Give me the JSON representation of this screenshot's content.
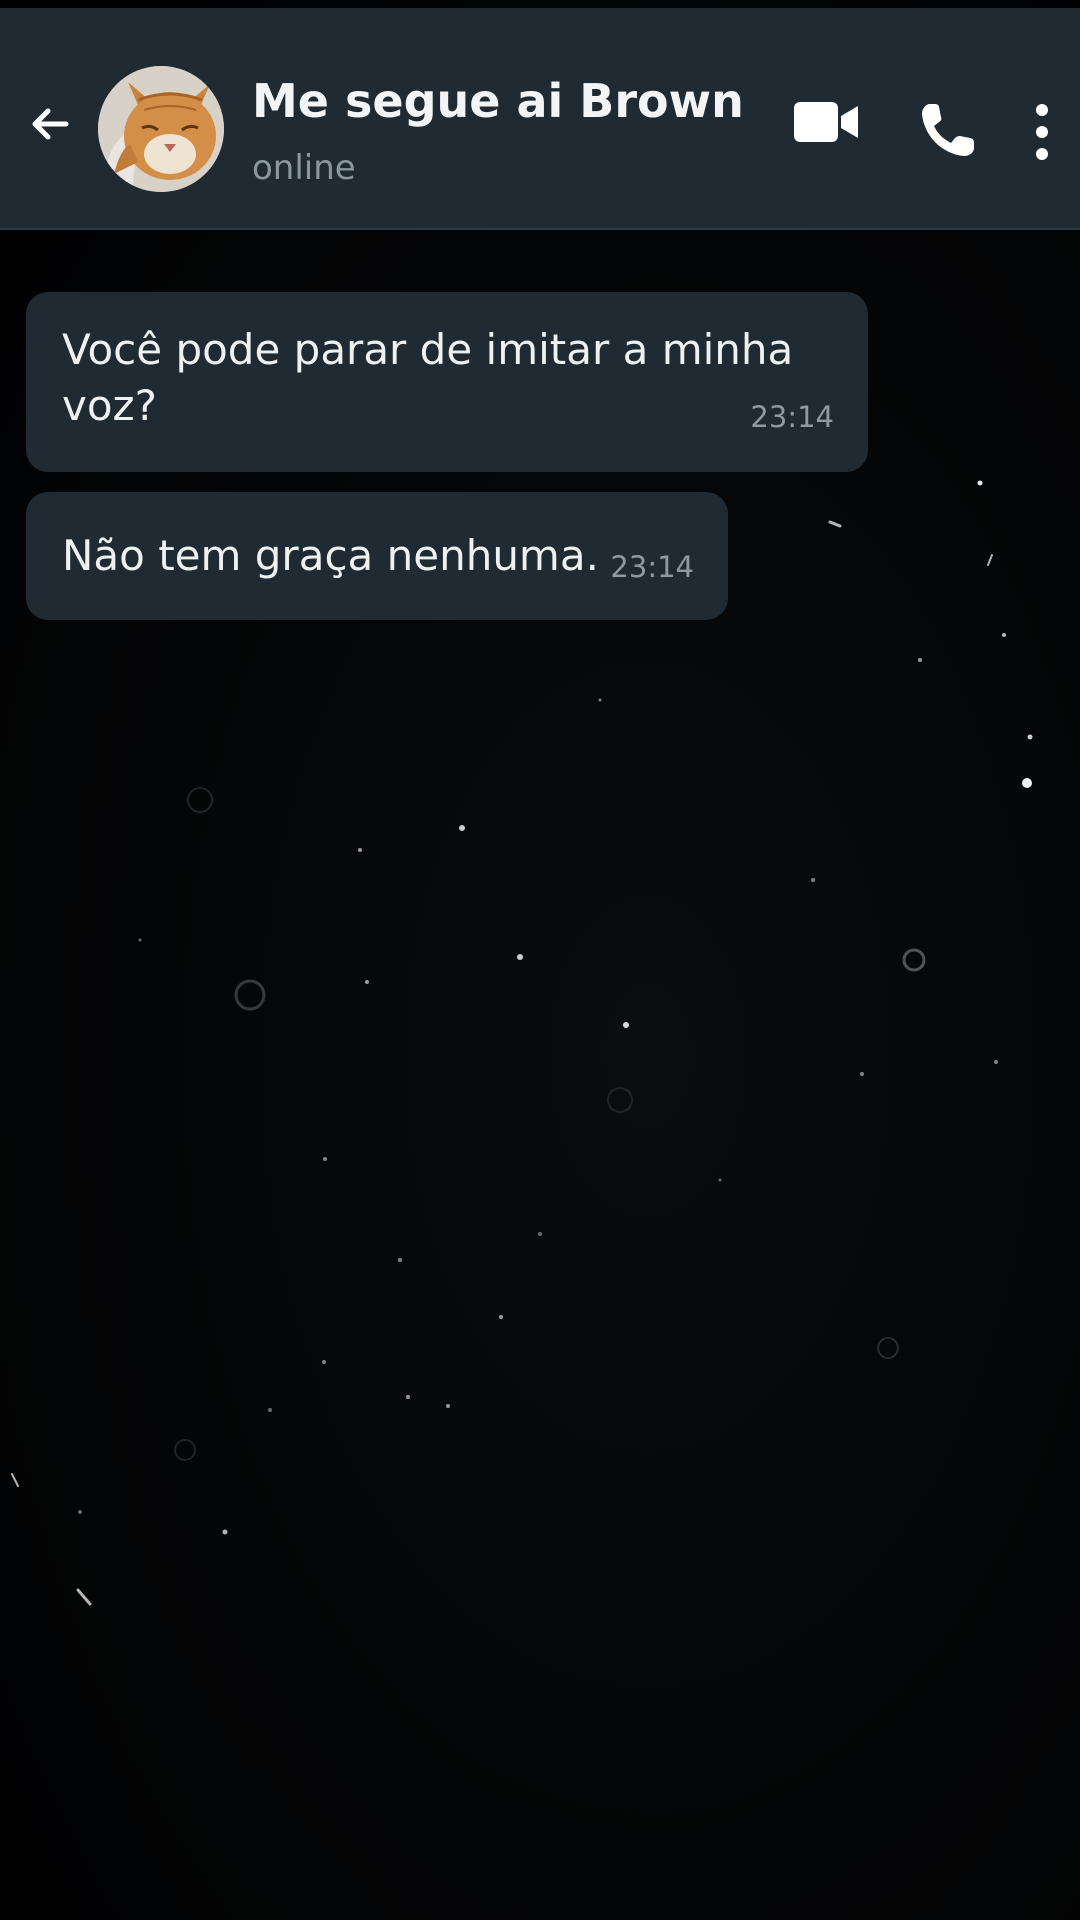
{
  "header": {
    "contact_name": "Me segue ai Brown",
    "status": "online",
    "back_icon": "arrow-left-icon",
    "video_icon": "video-camera-icon",
    "call_icon": "phone-icon",
    "menu_icon": "more-vertical-icon"
  },
  "messages": [
    {
      "text": "Você pode parar de imitar a minha voz?",
      "time": "23:14"
    },
    {
      "text": "Não tem graça nenhuma.",
      "time": "23:14"
    }
  ],
  "colors": {
    "header_bg": "#1f2a33",
    "bubble_bg": "#1f2a32",
    "background": "#020304"
  }
}
